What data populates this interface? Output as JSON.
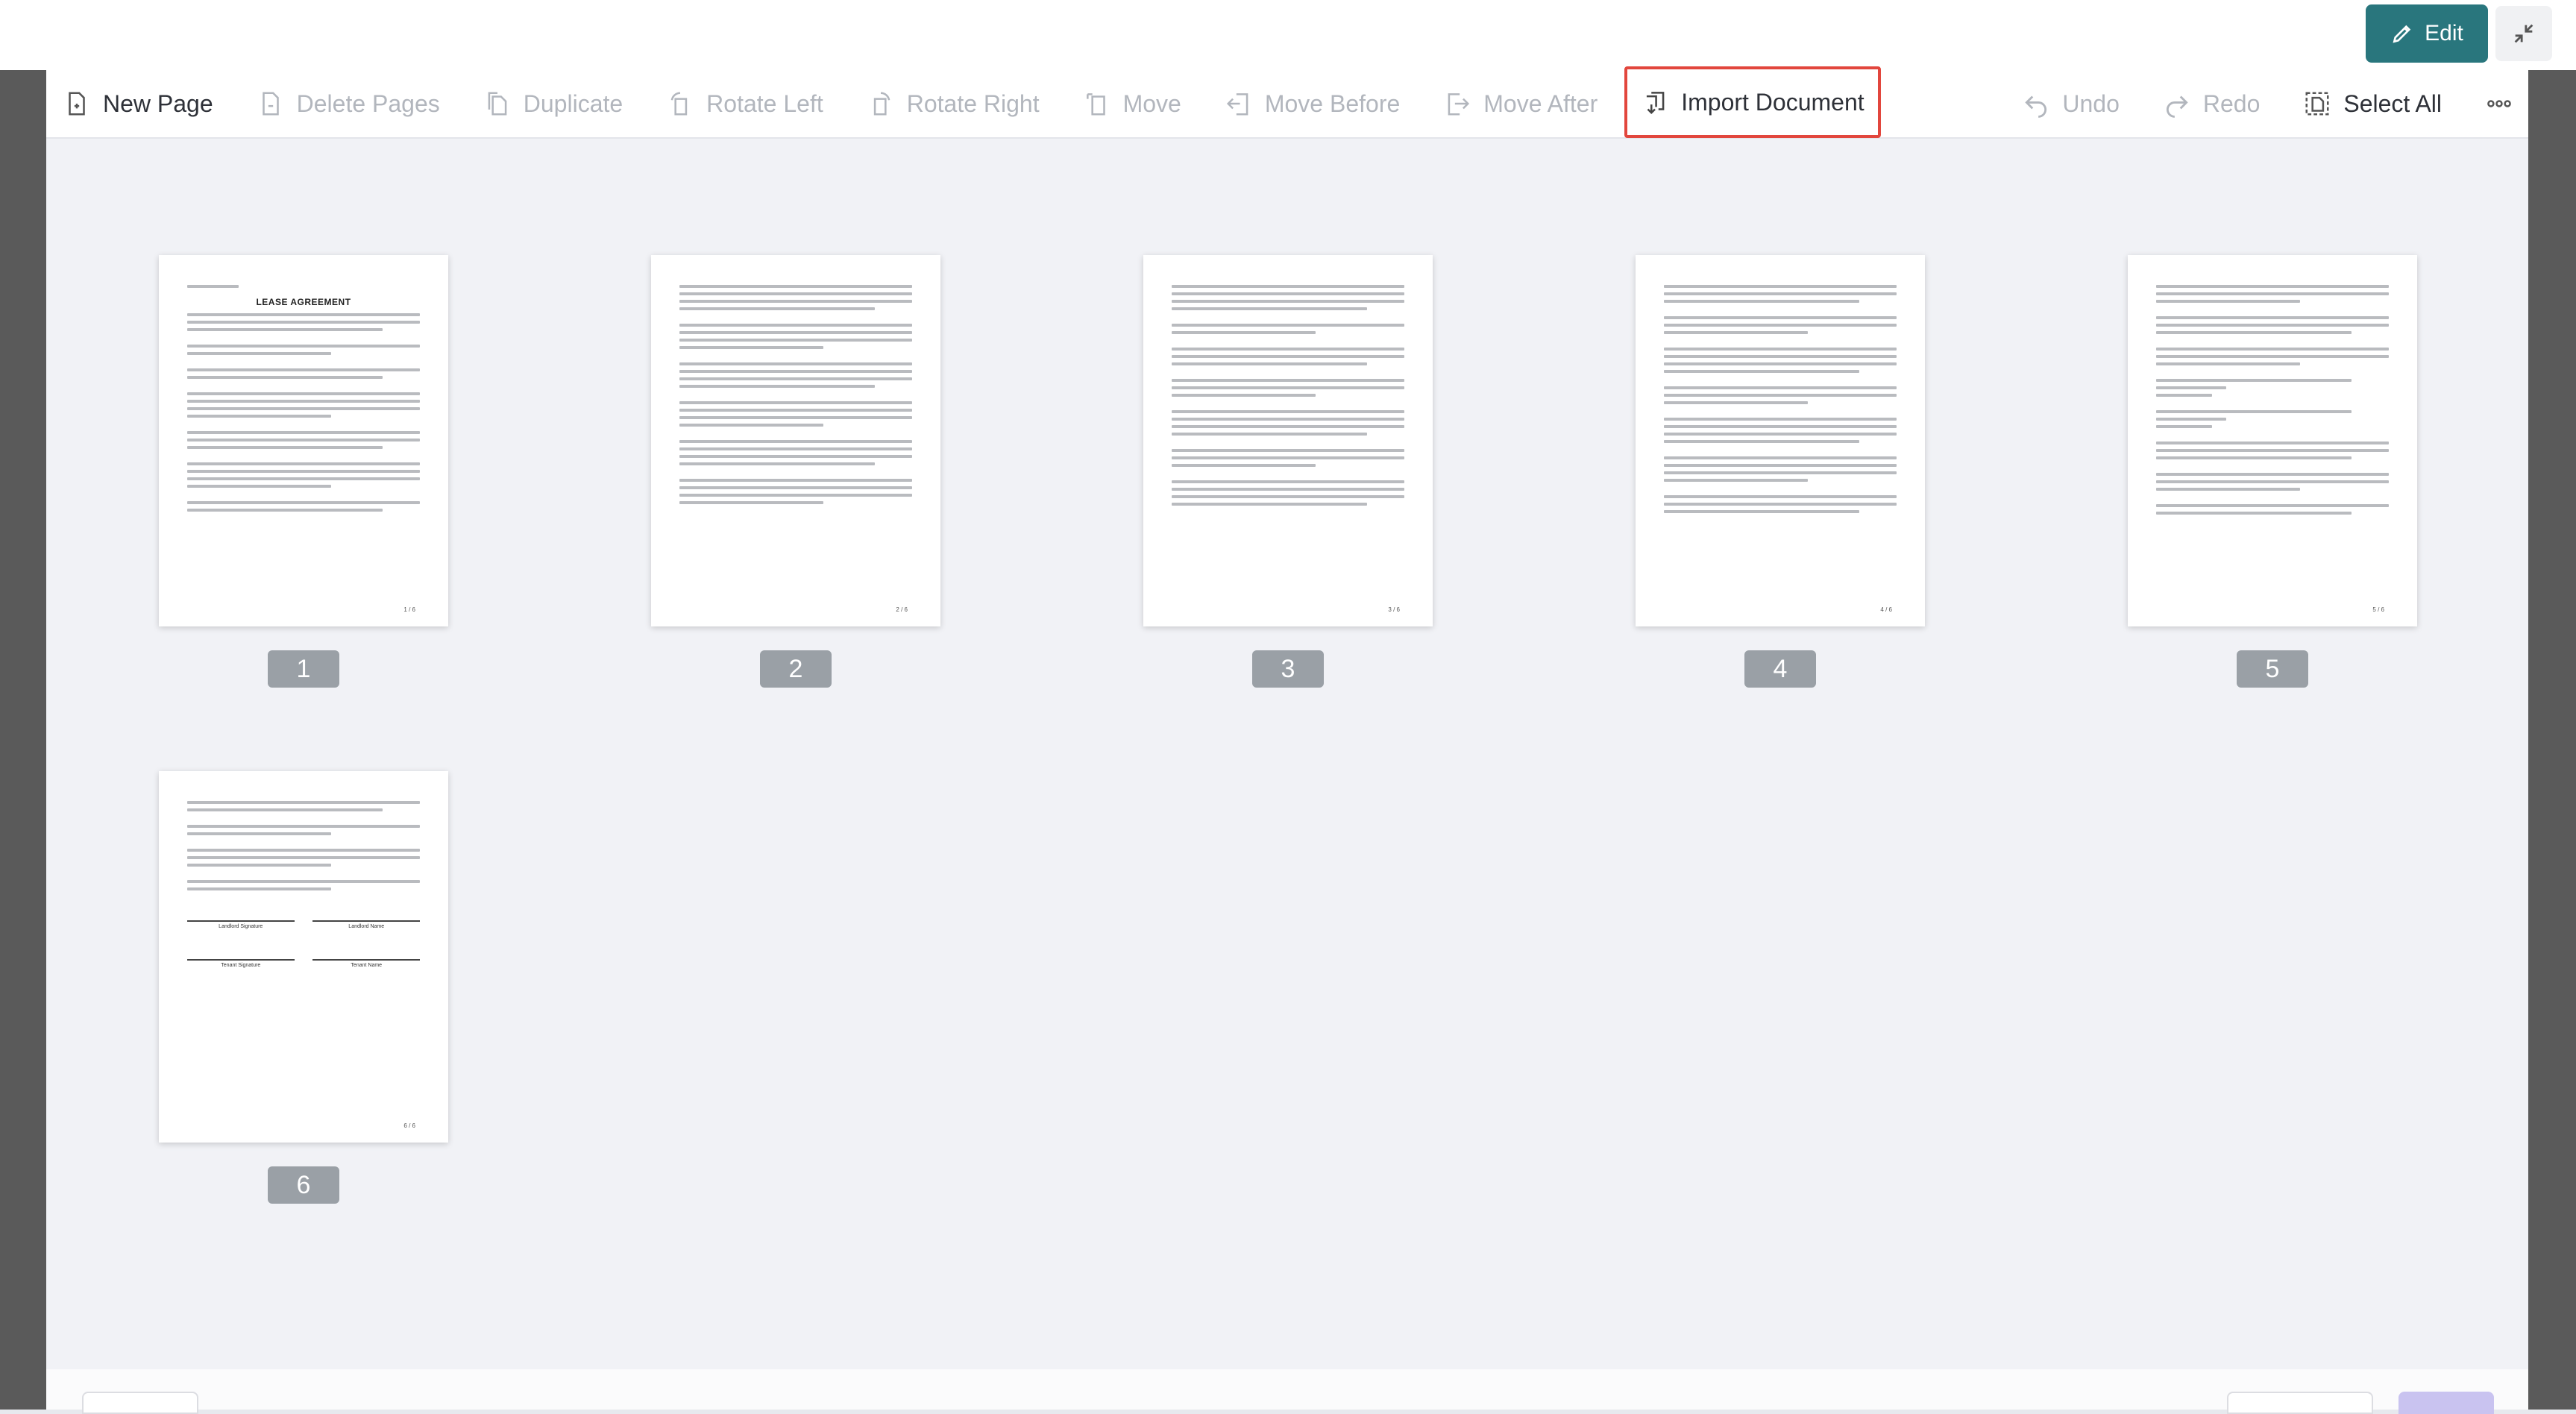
{
  "topbar": {
    "edit_label": "Edit"
  },
  "toolbar": {
    "new_page": "New Page",
    "delete_pages": "Delete Pages",
    "duplicate": "Duplicate",
    "rotate_left": "Rotate Left",
    "rotate_right": "Rotate Right",
    "move": "Move",
    "move_before": "Move Before",
    "move_after": "Move After",
    "import_document": "Import Document",
    "undo": "Undo",
    "redo": "Redo",
    "select_all": "Select All"
  },
  "pages": [
    {
      "number": "1",
      "title": "LEASE AGREEMENT",
      "footer": "1 / 6"
    },
    {
      "number": "2",
      "footer": "2 / 6"
    },
    {
      "number": "3",
      "footer": "3 / 6"
    },
    {
      "number": "4",
      "footer": "4 / 6"
    },
    {
      "number": "5",
      "footer": "5 / 6"
    },
    {
      "number": "6",
      "footer": "6 / 6",
      "sig1": "Landlord Signature",
      "sig2": "Landlord Name",
      "sig3": "Tenant Signature",
      "sig4": "Tenant Name"
    }
  ],
  "colors": {
    "accent": "#29767d",
    "highlight": "#e2463d"
  }
}
